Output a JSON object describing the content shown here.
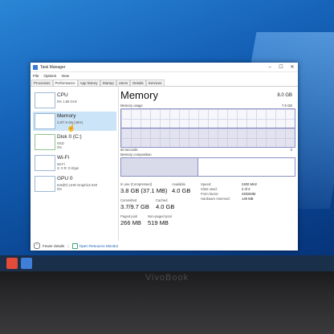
{
  "window": {
    "title": "Task Manager",
    "controls": {
      "minimize": "–",
      "maximize": "☐",
      "close": "✕"
    }
  },
  "menu": [
    "File",
    "Options",
    "View"
  ],
  "tabs": [
    "Processes",
    "Performance",
    "App history",
    "Startup",
    "Users",
    "Details",
    "Services"
  ],
  "active_tab": "Performance",
  "sidebar": [
    {
      "name": "CPU",
      "sub": "0% 1.80 GHz",
      "sub2": ""
    },
    {
      "name": "Memory",
      "sub": "3.8/7.9 GB (48%)",
      "sub2": ""
    },
    {
      "name": "Disk 0 (C:)",
      "sub": "SSD",
      "sub2": "0%"
    },
    {
      "name": "Wi-Fi",
      "sub": "Wi-Fi",
      "sub2": "S: 0 R: 0 Kbps"
    },
    {
      "name": "GPU 0",
      "sub": "Intel(R) UHD Graphics 620",
      "sub2": "0%"
    }
  ],
  "memory": {
    "title": "Memory",
    "total": "8.0 GB",
    "usage_label": "Memory usage",
    "usage_max": "7.9 GB",
    "time_span": "60 seconds",
    "zero": "0",
    "composition_label": "Memory composition",
    "usage_fraction": 0.48,
    "composition_used_fraction": 0.44,
    "stats": {
      "in_use_label": "In use (Compressed)",
      "in_use_value": "3.8 GB (37.1 MB)",
      "available_label": "Available",
      "available_value": "4.0 GB",
      "committed_label": "Committed",
      "committed_value": "3.7/9.7 GB",
      "cached_label": "Cached",
      "cached_value": "4.0 GB",
      "paged_label": "Paged pool",
      "paged_value": "266 MB",
      "nonpaged_label": "Non-paged pool",
      "nonpaged_value": "519 MB"
    },
    "specs": [
      {
        "key": "Speed:",
        "value": "2400 MHz"
      },
      {
        "key": "Slots used:",
        "value": "2 of 2"
      },
      {
        "key": "Form factor:",
        "value": "SODIMM"
      },
      {
        "key": "Hardware reserved:",
        "value": "149 MB"
      }
    ]
  },
  "footer": {
    "fewer_details": "Fewer details",
    "resource_monitor": "Open Resource Monitor"
  },
  "laptop_brand": "VivoBook"
}
